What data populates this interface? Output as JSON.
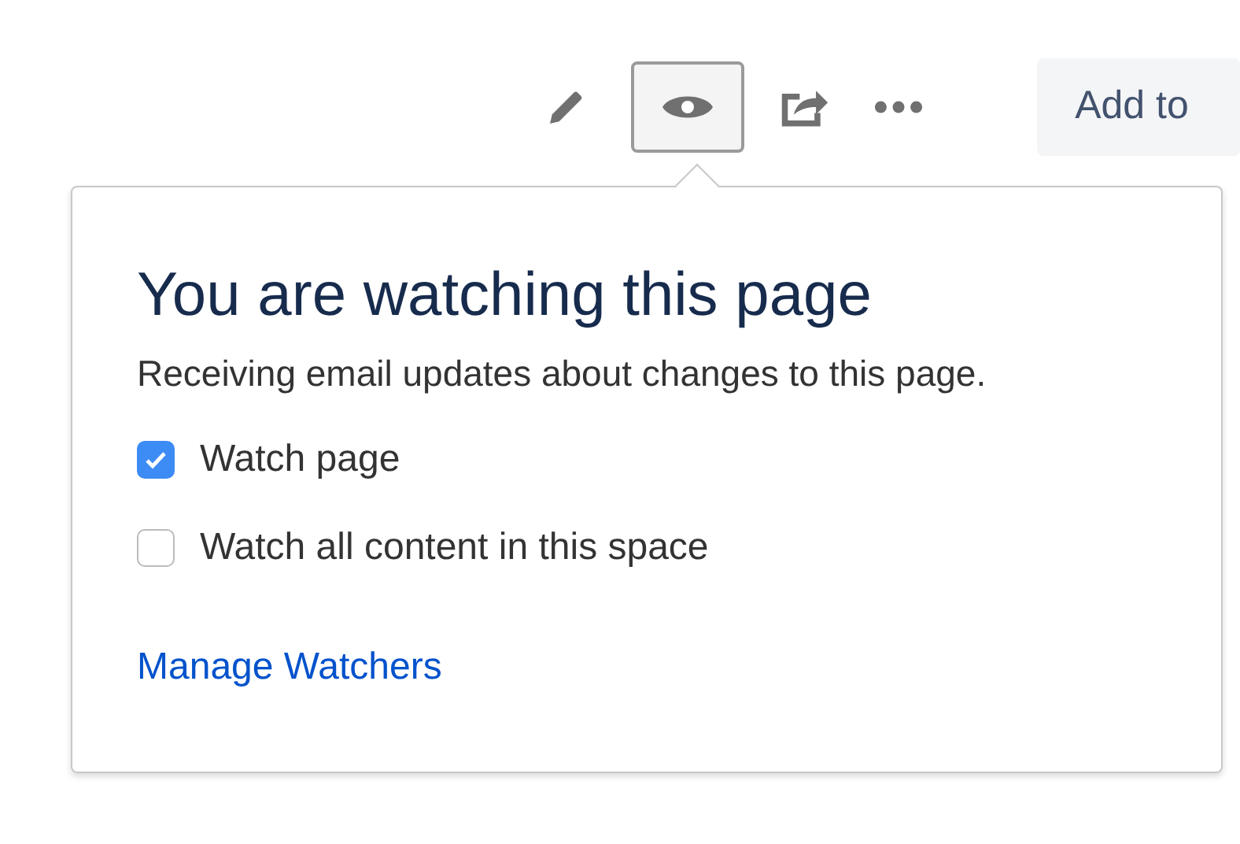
{
  "toolbar": {
    "buttons": [
      {
        "kind": "edit",
        "selected": false
      },
      {
        "kind": "watch",
        "selected": true
      },
      {
        "kind": "share",
        "selected": false
      },
      {
        "kind": "more",
        "selected": false
      }
    ],
    "add_button": {
      "label": "Add to"
    }
  },
  "popover": {
    "title": "You are watching this page",
    "description": "Receiving email updates about changes to this page.",
    "options": [
      {
        "label": "Watch page",
        "checked": true
      },
      {
        "label": "Watch all content in this space",
        "checked": false
      }
    ],
    "link": "Manage Watchers"
  }
}
